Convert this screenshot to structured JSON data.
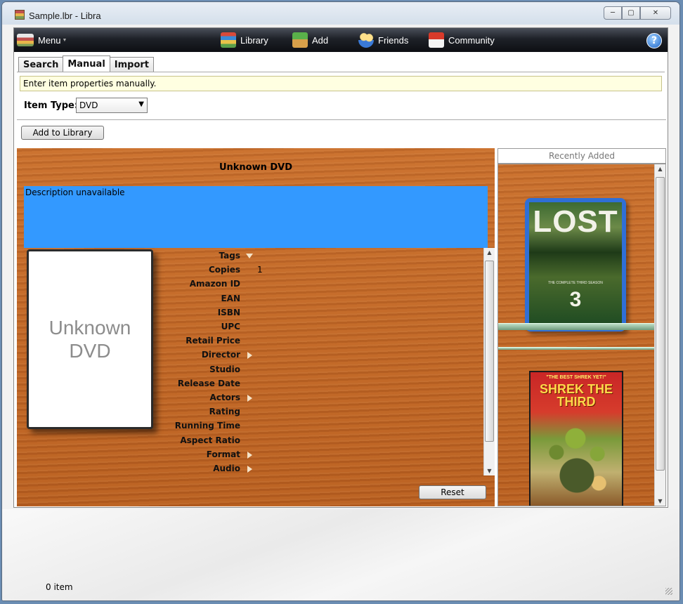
{
  "window": {
    "title": "Sample.lbr - Libra"
  },
  "toolbar": {
    "menu_label": "Menu",
    "items": [
      {
        "label": "Library",
        "icon": "books-icon"
      },
      {
        "label": "Add",
        "icon": "add-download-icon"
      },
      {
        "label": "Friends",
        "icon": "friends-icon"
      },
      {
        "label": "Community",
        "icon": "house-icon"
      }
    ],
    "help_label": "?"
  },
  "tabs": [
    {
      "label": "Search",
      "active": false
    },
    {
      "label": "Manual",
      "active": true
    },
    {
      "label": "Import",
      "active": false
    }
  ],
  "info": {
    "message": "Enter item properties manually."
  },
  "item_type": {
    "label": "Item Type:",
    "value": "DVD"
  },
  "actions": {
    "add_to_library": "Add to Library",
    "reset": "Reset"
  },
  "detail": {
    "title": "Unknown DVD",
    "description": "Description unavailable",
    "cover_text": "Unknown\nDVD",
    "fields": [
      {
        "label": "Tags",
        "value": "",
        "toggle": "down"
      },
      {
        "label": "Copies",
        "value": "1",
        "toggle": ""
      },
      {
        "label": "Amazon ID",
        "value": "",
        "toggle": ""
      },
      {
        "label": "EAN",
        "value": "",
        "toggle": ""
      },
      {
        "label": "ISBN",
        "value": "",
        "toggle": ""
      },
      {
        "label": "UPC",
        "value": "",
        "toggle": ""
      },
      {
        "label": "Retail Price",
        "value": "",
        "toggle": ""
      },
      {
        "label": "Director",
        "value": "",
        "toggle": "right"
      },
      {
        "label": "Studio",
        "value": "",
        "toggle": ""
      },
      {
        "label": "Release Date",
        "value": "",
        "toggle": ""
      },
      {
        "label": "Actors",
        "value": "",
        "toggle": "right"
      },
      {
        "label": "Rating",
        "value": "",
        "toggle": ""
      },
      {
        "label": "Running Time",
        "value": "",
        "toggle": ""
      },
      {
        "label": "Aspect Ratio",
        "value": "",
        "toggle": ""
      },
      {
        "label": "Format",
        "value": "",
        "toggle": "right"
      },
      {
        "label": "Audio",
        "value": "",
        "toggle": "right"
      }
    ]
  },
  "recent": {
    "header": "Recently Added",
    "items": [
      {
        "title": "LOST",
        "subtitle": "THE COMPLETE THIRD SEASON",
        "number": "3"
      },
      {
        "tagline": "\"THE BEST SHREK YET!\"",
        "title": "SHREK THE THIRD"
      }
    ]
  },
  "status": {
    "text": "0 item"
  },
  "colors": {
    "selection": "#3399ff",
    "info_bg": "#ffffe1",
    "wood": "#c86b2a"
  }
}
